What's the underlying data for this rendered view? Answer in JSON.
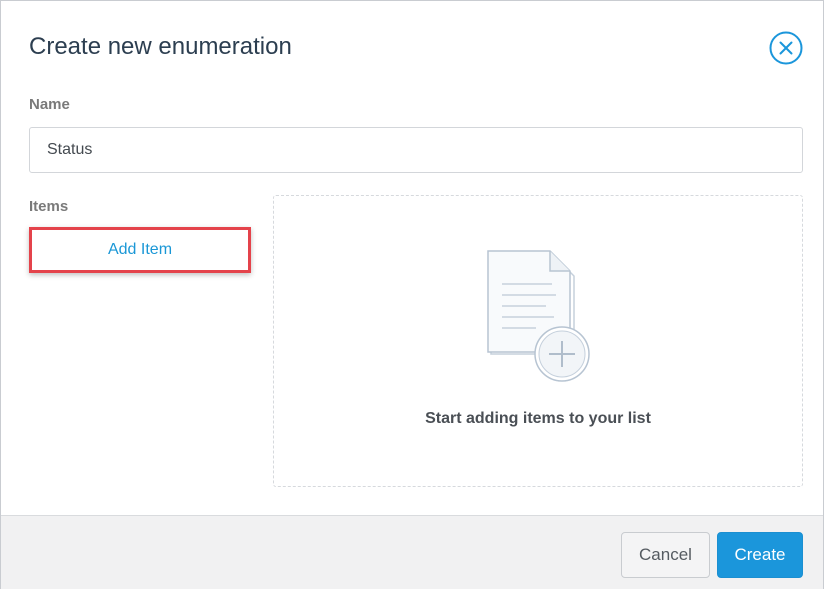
{
  "dialog": {
    "title": "Create new enumeration",
    "close_icon": "close-circle-x-icon"
  },
  "name_field": {
    "label": "Name",
    "value": "Status"
  },
  "items_section": {
    "label": "Items",
    "add_item_label": "Add Item",
    "empty_icon": "document-add-icon",
    "empty_message": "Start adding items to your list"
  },
  "footer": {
    "cancel_label": "Cancel",
    "create_label": "Create"
  },
  "colors": {
    "accent": "#1b96db",
    "highlight_border": "#e4434b",
    "title_text": "#2c3e50"
  }
}
